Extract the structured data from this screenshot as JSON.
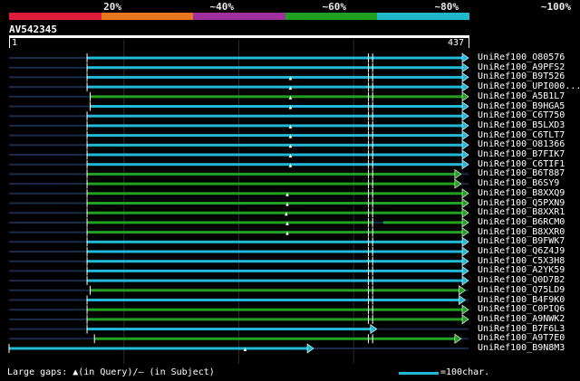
{
  "scale": {
    "colors": [
      "#e01c3c",
      "#e87820",
      "#a030a0",
      "#20a020",
      "#20b8c8"
    ],
    "labels": [
      "20%",
      "~40%",
      "~60%",
      "~80%",
      "~100%"
    ]
  },
  "query": {
    "name": "AV542345",
    "start": "1",
    "end": "437",
    "length": 437
  },
  "colors": {
    "long": "#22b8d8",
    "short": "#22a022",
    "dim": "#1a2c4a",
    "grid": "#2a2a2a",
    "marker": "#ffffff"
  },
  "hits": [
    {
      "label": "UniRef100_O80576",
      "start": 75,
      "end": 437,
      "color": "long",
      "gap": null,
      "mark": null
    },
    {
      "label": "UniRef100_A9PFS2",
      "start": 75,
      "end": 437,
      "color": "long",
      "gap": null,
      "mark": null
    },
    {
      "label": "UniRef100_B9T526",
      "start": 75,
      "end": 437,
      "color": "long",
      "gap": null,
      "mark": 268
    },
    {
      "label": "UniRef100_UPI000...",
      "start": 75,
      "end": 437,
      "color": "long",
      "gap": null,
      "mark": 268
    },
    {
      "label": "UniRef100_A5B1L7",
      "start": 78,
      "end": 437,
      "color": "short",
      "gap": null,
      "mark": 268
    },
    {
      "label": "UniRef100_B9HGA5",
      "start": 78,
      "end": 437,
      "color": "long",
      "gap": null,
      "mark": 268
    },
    {
      "label": "UniRef100_C6T750",
      "start": 75,
      "end": 437,
      "color": "long",
      "gap": null,
      "mark": null
    },
    {
      "label": "UniRef100_B5LXD3",
      "start": 75,
      "end": 437,
      "color": "long",
      "gap": null,
      "mark": 268
    },
    {
      "label": "UniRef100_C6TLT7",
      "start": 75,
      "end": 437,
      "color": "long",
      "gap": null,
      "mark": 268
    },
    {
      "label": "UniRef100_O81366",
      "start": 75,
      "end": 437,
      "color": "long",
      "gap": null,
      "mark": 268
    },
    {
      "label": "UniRef100_B7FIK7",
      "start": 75,
      "end": 437,
      "color": "long",
      "gap": null,
      "mark": 268
    },
    {
      "label": "UniRef100_C6TIF1",
      "start": 75,
      "end": 437,
      "color": "long",
      "gap": null,
      "mark": 268
    },
    {
      "label": "UniRef100_B6T887",
      "start": 75,
      "end": 430,
      "color": "short",
      "gap": null,
      "mark": null
    },
    {
      "label": "UniRef100_B6SY9",
      "start": 75,
      "end": 430,
      "color": "short",
      "gap": null,
      "mark": null
    },
    {
      "label": "UniRef100_B8XXQ9",
      "start": 75,
      "end": 437,
      "color": "short",
      "gap": null,
      "mark": 265
    },
    {
      "label": "UniRef100_Q5PXN9",
      "start": 75,
      "end": 437,
      "color": "short",
      "gap": null,
      "mark": 265
    },
    {
      "label": "UniRef100_B8XXR1",
      "start": 75,
      "end": 437,
      "color": "short",
      "gap": null,
      "mark": 264
    },
    {
      "label": "UniRef100_B6RCM0",
      "start": 75,
      "end": 437,
      "color": "short",
      "gap": [
        352,
        356
      ],
      "mark": 265
    },
    {
      "label": "UniRef100_B8XXR0",
      "start": 75,
      "end": 437,
      "color": "short",
      "gap": null,
      "mark": 265
    },
    {
      "label": "UniRef100_B9FWK7",
      "start": 75,
      "end": 437,
      "color": "long",
      "gap": null,
      "mark": null
    },
    {
      "label": "UniRef100_Q6Z4J9",
      "start": 75,
      "end": 437,
      "color": "long",
      "gap": null,
      "mark": null
    },
    {
      "label": "UniRef100_C5X3H8",
      "start": 75,
      "end": 437,
      "color": "long",
      "gap": null,
      "mark": null
    },
    {
      "label": "UniRef100_A2YK59",
      "start": 75,
      "end": 437,
      "color": "long",
      "gap": null,
      "mark": null
    },
    {
      "label": "UniRef100_Q0D7B2",
      "start": 75,
      "end": 437,
      "color": "long",
      "gap": null,
      "mark": null
    },
    {
      "label": "UniRef100_Q75LD9",
      "start": 78,
      "end": 434,
      "color": "short",
      "gap": null,
      "mark": null
    },
    {
      "label": "UniRef100_B4F9K0",
      "start": 75,
      "end": 434,
      "color": "long",
      "gap": null,
      "mark": null
    },
    {
      "label": "UniRef100_C0PIQ6",
      "start": 75,
      "end": 437,
      "color": "short",
      "gap": null,
      "mark": null
    },
    {
      "label": "UniRef100_A9NWK2",
      "start": 75,
      "end": 437,
      "color": "short",
      "gap": null,
      "mark": null
    },
    {
      "label": "UniRef100_B7F6L3",
      "start": 75,
      "end": 350,
      "color": "long",
      "gap": null,
      "mark": null
    },
    {
      "label": "UniRef100_A9T7E0",
      "start": 82,
      "end": 430,
      "color": "short",
      "gap": null,
      "mark": null
    },
    {
      "label": "UniRef100_B9N8M3",
      "start": 1,
      "end": 290,
      "color": "long",
      "gap": null,
      "mark": 225
    }
  ],
  "legend": {
    "gaps": "Large gaps: ▲(in Query)/– (in Subject)",
    "scale": "=100char."
  }
}
